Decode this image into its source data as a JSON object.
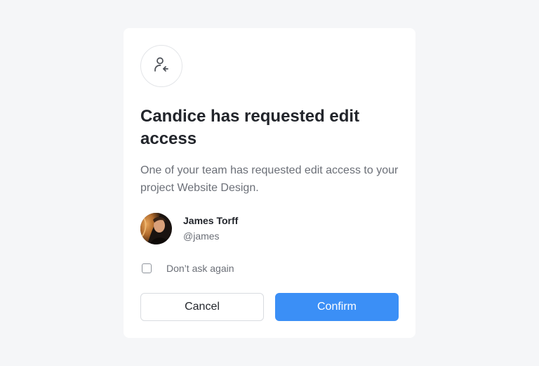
{
  "modal": {
    "icon": "user-request-icon",
    "title": "Candice has requested edit access",
    "description": "One of your team has requested edit access to your project Website Design.",
    "user": {
      "name": "James Torff",
      "handle": "@james"
    },
    "checkbox": {
      "label": "Don’t ask again",
      "checked": false
    },
    "buttons": {
      "cancel_label": "Cancel",
      "confirm_label": "Confirm"
    }
  },
  "colors": {
    "background": "#f5f6f8",
    "card": "#ffffff",
    "heading": "#22252b",
    "body_text": "#6b6f77",
    "primary": "#3b8ff6"
  }
}
